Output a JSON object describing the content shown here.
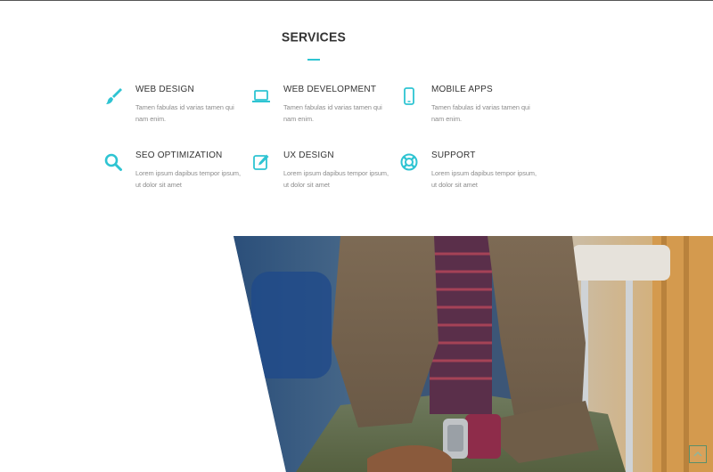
{
  "section": {
    "title": "SERVICES"
  },
  "services": [
    {
      "name": "WEB DESIGN",
      "desc": "Tamen fabulas id varias tamen qui nam enim.",
      "icon": "paintbrush-icon"
    },
    {
      "name": "WEB DEVELOPMENT",
      "desc": "Tamen fabulas id varias tamen qui nam enim.",
      "icon": "laptop-icon"
    },
    {
      "name": "MOBILE APPS",
      "desc": "Tamen fabulas id varias tamen qui nam enim.",
      "icon": "mobile-phone-icon"
    },
    {
      "name": "SEO OPTIMIZATION",
      "desc": "Lorem ipsum dapibus tempor ipsum, ut dolor sit amet",
      "icon": "magnifier-icon"
    },
    {
      "name": "UX DESIGN",
      "desc": "Lorem ipsum dapibus tempor ipsum, ut dolor sit amet",
      "icon": "edit-icon"
    },
    {
      "name": "SUPPORT",
      "desc": "Lorem ipsum dapibus tempor ipsum, ut dolor sit amet",
      "icon": "lifebuoy-icon"
    }
  ],
  "colors": {
    "accent": "#2ec4d2",
    "heading": "#333333",
    "body_text": "#8a8a8a"
  },
  "photo": {
    "subject": "seated-man-photo"
  },
  "scroll_top": {
    "icon": "chevron-up-icon"
  }
}
